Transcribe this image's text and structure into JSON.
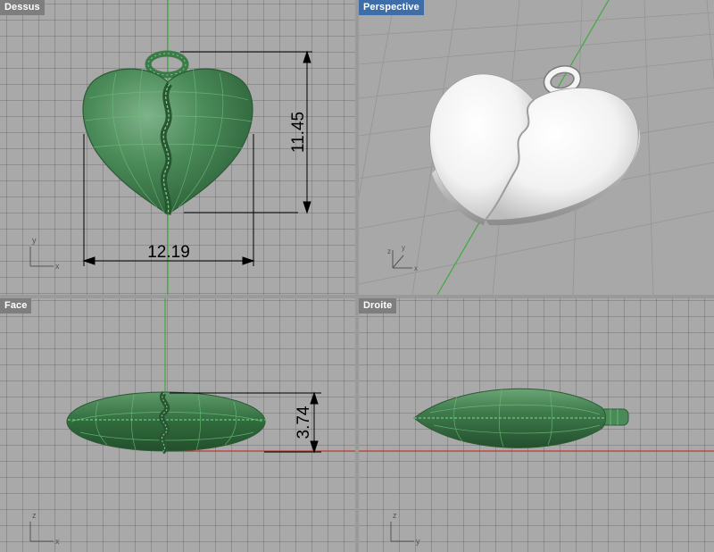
{
  "viewports": {
    "top": {
      "label": "Dessus",
      "axis_h": "x",
      "axis_v": "y"
    },
    "perspective": {
      "label": "Perspective",
      "axis_h": "x",
      "axis_v": "y",
      "axis_z": "z"
    },
    "front": {
      "label": "Face",
      "axis_h": "x",
      "axis_v": "z"
    },
    "right": {
      "label": "Droite",
      "axis_h": "y",
      "axis_v": "z"
    }
  },
  "dimensions": {
    "height": "11.45",
    "width": "12.19",
    "thickness": "3.74"
  },
  "colors": {
    "active_label": "#3d6ea8",
    "inactive_label": "#7e7e7e",
    "model_green": "#3f7a4c",
    "selection_wire": "#5cd36a",
    "axis_y_line": "#3faa3f",
    "axis_x_line": "#c0392b",
    "grid_bg": "#a9a9a9"
  },
  "icons": [
    "axis-widget-icon"
  ]
}
